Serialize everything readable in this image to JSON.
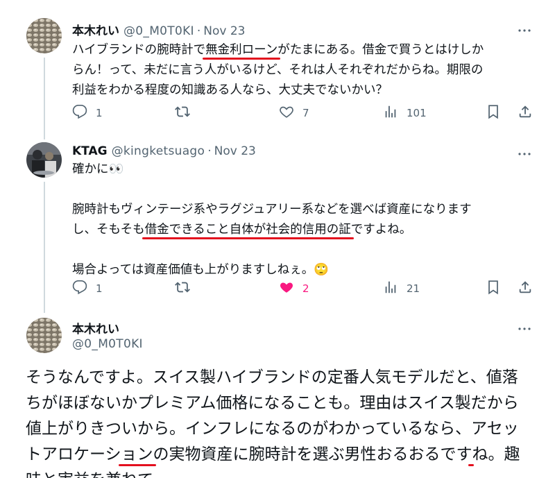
{
  "tweets": [
    {
      "name": "本木れい",
      "handle": "@0_M0T0KI",
      "sep": "·",
      "time": "Nov 23",
      "lines": [
        [
          "ハイブランドの腕時計で",
          {
            "m": "無金利ローン"
          },
          "がたまにある。借金で買うとはけしか"
        ],
        [
          "らん！って、未だに言う人がいるけど、それは人それぞれだからね。期限の"
        ],
        [
          "利益をわかる程度の知識ある人なら、大丈夫でないかい？"
        ]
      ],
      "replies": "1",
      "retweets": "",
      "likes": "7",
      "views": "101"
    },
    {
      "name": "KTAG",
      "handle": "@kingketsuago",
      "sep": "·",
      "time": "Nov 23",
      "lines": [
        [
          "確かに👀"
        ],
        [],
        [
          "腕時計もヴィンテージ系やラグジュアリー系などを選べば資産になります"
        ],
        [
          "し、そもそも",
          {
            "m": "借金できること自体が社会的信用の証"
          },
          "ですよね。"
        ],
        [],
        [
          "場合よっては資産価値も上がりますしねぇ。🙄"
        ]
      ],
      "replies": "1",
      "retweets": "",
      "likes": "2",
      "views": "21"
    },
    {
      "name": "本木れい",
      "handle": "@0_M0T0KI",
      "lines": [
        [
          "そうなんですよ。スイス製ハイブランドの定番人気モデルだと、値落ちが"
        ],
        [
          "ほぼないかプレミアム価格になることも。理由はスイス製だから値上がり"
        ],
        [
          "きついから。インフレになるのがわかっているなら、",
          {
            "m": "アセットアロケーシ"
          }
        ],
        [
          {
            "m": "ョン"
          },
          "の実物資産に腕時計を選ぶ男性おるおるですね。趣味と実益を兼ね"
        ],
        [
          "て。"
        ]
      ]
    }
  ],
  "colors": {
    "highlight": "#e3101e",
    "like": "#f91880",
    "muted": "#536471"
  },
  "icons": [
    "reply-icon",
    "retweet-icon",
    "like-icon",
    "views-icon",
    "bookmark-icon",
    "share-icon",
    "more-icon"
  ]
}
